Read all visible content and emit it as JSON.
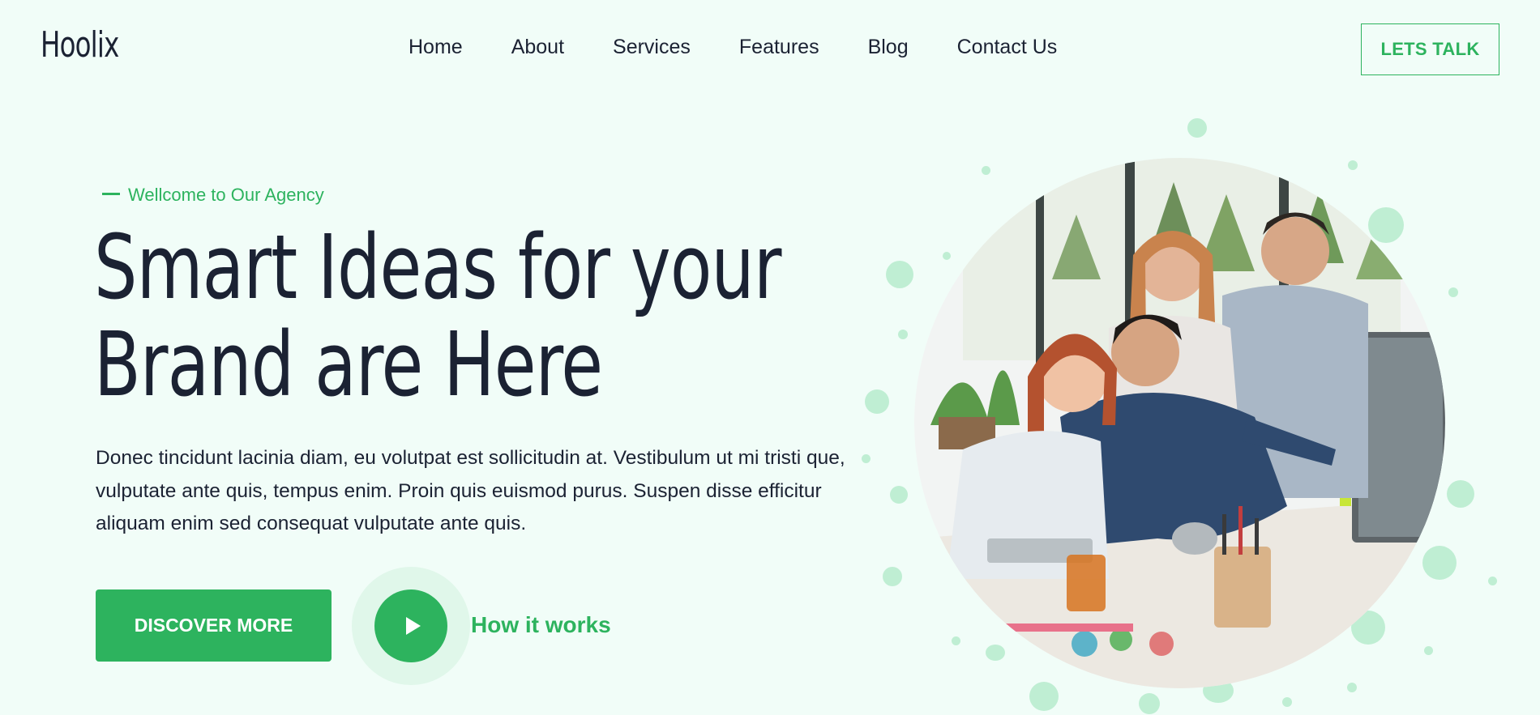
{
  "header": {
    "logo": "Hoolix",
    "nav": [
      "Home",
      "About",
      "Services",
      "Features",
      "Blog",
      "Contact Us"
    ],
    "cta_label": "LETS TALK"
  },
  "hero": {
    "eyebrow": "Wellcome to Our Agency",
    "title_line1": "Smart Ideas for your",
    "title_line2": "Brand are Here",
    "description": "Donec tincidunt lacinia diam, eu volutpat est sollicitudin at. Vestibulum ut mi tristi que, vulputate ante quis, tempus enim. Proin quis euismod purus. Suspen disse efficitur aliquam enim sed consequat vulputate ante quis.",
    "primary_button": "DISCOVER MORE",
    "video_link": "How it works"
  },
  "colors": {
    "accent": "#2db35e",
    "background": "#f1fdf8",
    "text": "#1b2233",
    "dots": "#bfeed3"
  },
  "icons": {
    "play": "play-icon",
    "eyebrow_dash": "dash-icon"
  }
}
